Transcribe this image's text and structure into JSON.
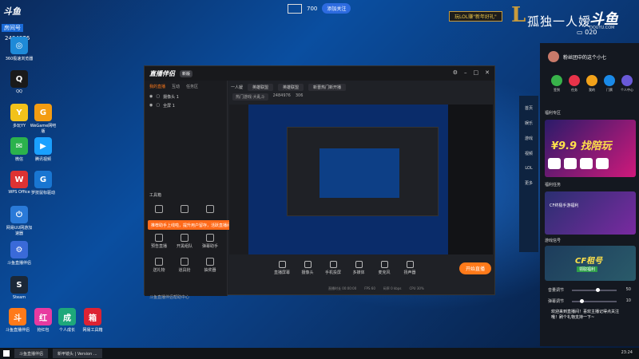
{
  "overlay": {
    "douyu_top_left": "斗鱼",
    "room_label": "房间号",
    "room_number": "2484976",
    "top_center_monitor": "700",
    "top_center_chip": "添加关注",
    "lol_banner": "玩LOL赚\"新年好礼\"",
    "streamer_name": "孤独一人嫒",
    "douyu_logo": "斗鱼",
    "douyu_url": "DOUYU.COM",
    "viewer_count": "020"
  },
  "desktop_icons": [
    {
      "label": "360极速浏览器",
      "color": "#1e8ad8",
      "glyph": "◎"
    },
    {
      "label": "QQ",
      "color": "#1a1a1a",
      "glyph": "Q"
    },
    {
      "label": "多玩YY",
      "color": "#f2c21a",
      "glyph": "Y"
    },
    {
      "label": "WeGame网吧版",
      "color": "#f39c12",
      "glyph": "G"
    },
    {
      "label": "微信",
      "color": "#2bb24c",
      "glyph": "✉"
    },
    {
      "label": "腾讯视频",
      "color": "#1aa0ff",
      "glyph": "▶"
    },
    {
      "label": "WPS Office",
      "color": "#d33",
      "glyph": "W"
    },
    {
      "label": "罗技鼠标驱动",
      "color": "#1976d2",
      "glyph": "G"
    },
    {
      "label": "网易UU网游加速器",
      "color": "#2a7ad8",
      "glyph": "⏻"
    },
    {
      "label": "斗鱼直播伴侣",
      "color": "#3a6ad8",
      "glyph": "⚙"
    },
    {
      "label": "Steam",
      "color": "#1b2838",
      "glyph": "S"
    },
    {
      "label": "斗鱼直播伴侣",
      "color": "#ff7a1a",
      "glyph": "斗"
    },
    {
      "label": "抢红包",
      "color": "#e83aa0",
      "glyph": "红"
    },
    {
      "label": "个人成长",
      "color": "#1ea87a",
      "glyph": "成"
    },
    {
      "label": "网易工具箱",
      "color": "#d23",
      "glyph": "箱"
    }
  ],
  "app": {
    "logo": "直播伴侣",
    "version": "新版",
    "tabs": [
      "我的直播",
      "互动",
      "任务区"
    ],
    "scenes": [
      "摄像头 1",
      "全屏 1"
    ],
    "tools_title": "工具箱",
    "tip": "推荐助手上线啦，提升用户留存，活跃直播间热度！",
    "tools": [
      {
        "label": "预告直播"
      },
      {
        "label": "开黑组队"
      },
      {
        "label": "弹幕助手"
      },
      {
        "label": "送礼物"
      },
      {
        "label": "道具抢"
      },
      {
        "label": "抽奖器"
      }
    ],
    "footer_note": "斗鱼直播伴侣帮助中心",
    "info": {
      "room_title": "一人嫒",
      "area": "英雄联盟",
      "category": "英雄联盟",
      "tags": "新晋热门新开播"
    },
    "info2": {
      "tag": "热门游戏·大乱斗",
      "uid": "2484976",
      "num": "306"
    },
    "bottom_tools": [
      "直播屏幕",
      "摄像头",
      "手机投屏",
      "多媒体",
      "麦克风",
      "扬声器"
    ],
    "go_live": "开始直播",
    "status_items": [
      "直播时长 00:00:00",
      "FPS 60",
      "码率 0 kbps",
      "CPU 30%"
    ]
  },
  "right_panel": {
    "user": "粉丝团中的这个小七",
    "quick": [
      {
        "label": "签到",
        "color": "#38b24a"
      },
      {
        "label": "任务",
        "color": "#e8334a"
      },
      {
        "label": "我的",
        "color": "#f2a21a"
      },
      {
        "label": "门票",
        "color": "#1a8ae8"
      },
      {
        "label": "个人中心",
        "color": "#6a5ad8"
      }
    ],
    "nav": [
      "首页",
      "娱乐",
      "游戏",
      "视频",
      "LOL",
      "更多"
    ],
    "section1": "福利专区",
    "promo_big": "¥9.9 找陪玩",
    "section2": "福利任务",
    "card2_text": "CF终极手游福利",
    "section3": "游戏信号",
    "card3_big": "CF租号",
    "card3_sub": "领取福利",
    "slider1": {
      "label": "音量调节",
      "value": "50"
    },
    "slider2": {
      "label": "弹幕调节",
      "value": "10"
    },
    "danmu": "欢迎来到直播间！喜欢主播记得点关注哦！刷个礼物支持一下~"
  },
  "taskbar": {
    "tasks": [
      "斗鱼直播伴侣",
      "新甲镜头 | Version ..."
    ],
    "clock": "23:24"
  }
}
